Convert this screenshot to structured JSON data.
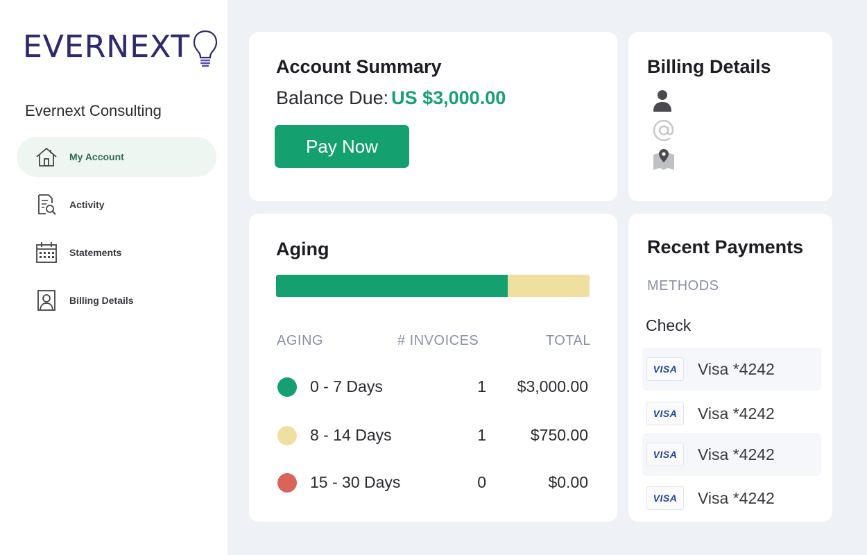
{
  "brand": {
    "logo_text": "EVERNEXT",
    "company": "Evernext Consulting"
  },
  "nav": [
    {
      "label": "My Account",
      "icon": "home-icon",
      "active": true
    },
    {
      "label": "Activity",
      "icon": "document-search-icon",
      "active": false
    },
    {
      "label": "Statements",
      "icon": "calendar-icon",
      "active": false
    },
    {
      "label": "Billing Details",
      "icon": "user-card-icon",
      "active": false
    }
  ],
  "summary": {
    "title": "Account Summary",
    "balance_label": "Balance Due:",
    "balance_amount": "US $3,000.00",
    "pay_button": "Pay Now"
  },
  "billing": {
    "title": "Billing Details",
    "icons": [
      "person-icon",
      "at-sign-icon",
      "map-pin-icon"
    ]
  },
  "aging": {
    "title": "Aging",
    "bar": [
      {
        "fraction": 0.74,
        "color": "#15a06f"
      },
      {
        "fraction": 0.26,
        "color": "#efe0a1"
      }
    ],
    "columns": {
      "aging": "AGING",
      "invoices": "# INVOICES",
      "total": "TOTAL"
    },
    "rows": [
      {
        "label": "0 - 7 Days",
        "count": "1",
        "total": "$3,000.00",
        "color": "#15a06f"
      },
      {
        "label": "8 - 14 Days",
        "count": "1",
        "total": "$750.00",
        "color": "#efe0a1"
      },
      {
        "label": "15 - 30 Days",
        "count": "0",
        "total": "$0.00",
        "color": "#d9645a"
      }
    ]
  },
  "payments": {
    "title": "Recent Payments",
    "methods_label": "METHODS",
    "check_label": "Check",
    "items": [
      {
        "badge": "VISA",
        "label": "Visa *4242"
      },
      {
        "badge": "VISA",
        "label": "Visa *4242"
      },
      {
        "badge": "VISA",
        "label": "Visa *4242"
      },
      {
        "badge": "VISA",
        "label": "Visa *4242"
      }
    ]
  }
}
